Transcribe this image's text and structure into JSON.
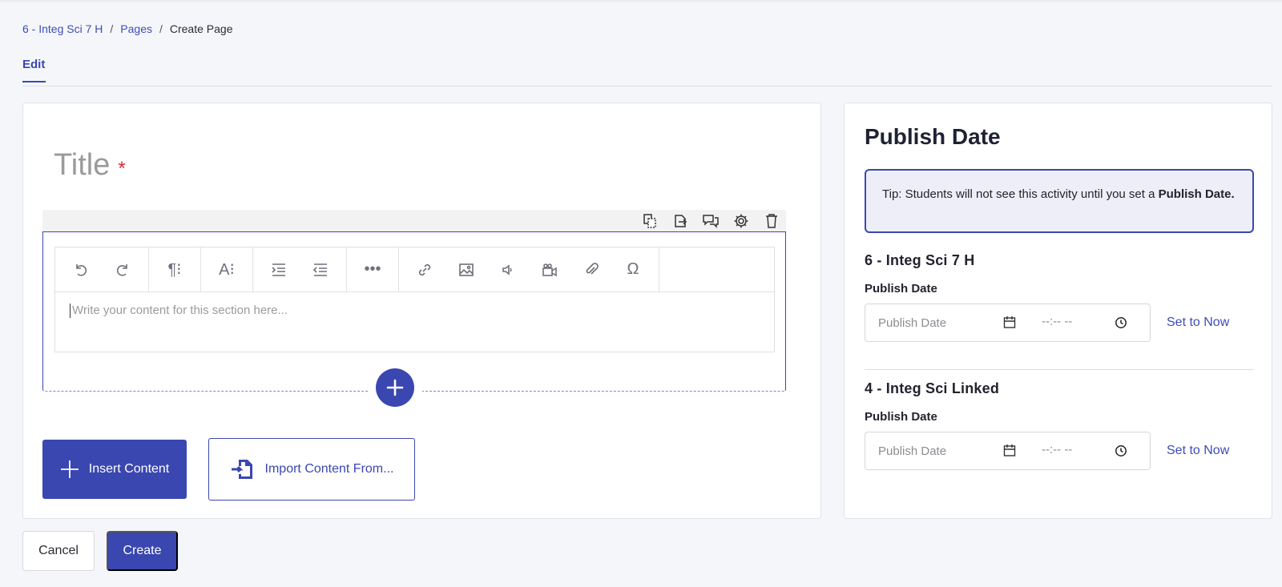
{
  "breadcrumb": {
    "course": "6 - Integ Sci 7 H",
    "pages": "Pages",
    "current": "Create Page",
    "separator": "/"
  },
  "tabs": {
    "edit": "Edit"
  },
  "editor": {
    "title_placeholder": "Title",
    "required_mark": "*",
    "content_placeholder": "Write your content for this section here...",
    "section_toolbar_icons": [
      "duplicate-icon",
      "move-out-icon",
      "comment-icon",
      "settings-icon",
      "delete-icon"
    ],
    "toolbar_icons": [
      "undo-icon",
      "redo-icon",
      "paragraph-format-icon",
      "text-style-icon",
      "indent-icon",
      "outdent-icon",
      "more-icon",
      "link-icon",
      "image-icon",
      "audio-icon",
      "video-icon",
      "attachment-icon",
      "special-character-icon"
    ],
    "insert_content": "Insert Content",
    "import_content": "Import Content From..."
  },
  "publish": {
    "title": "Publish Date",
    "tip_text": "Tip: Students will not see this activity until you set a ",
    "tip_bold": "Publish Date.",
    "courses": [
      {
        "name": "6 - Integ Sci 7 H",
        "label": "Publish Date",
        "date_placeholder": "Publish Date",
        "time_placeholder": "--:-- --",
        "set_now": "Set to Now"
      },
      {
        "name": "4 - Integ Sci Linked",
        "label": "Publish Date",
        "date_placeholder": "Publish Date",
        "time_placeholder": "--:-- --",
        "set_now": "Set to Now"
      }
    ]
  },
  "actions": {
    "cancel": "Cancel",
    "create": "Create"
  },
  "colors": {
    "accent": "#3a47b0",
    "link": "#3e4db5",
    "required": "#e0272f",
    "tip_bg": "#edeef8"
  }
}
